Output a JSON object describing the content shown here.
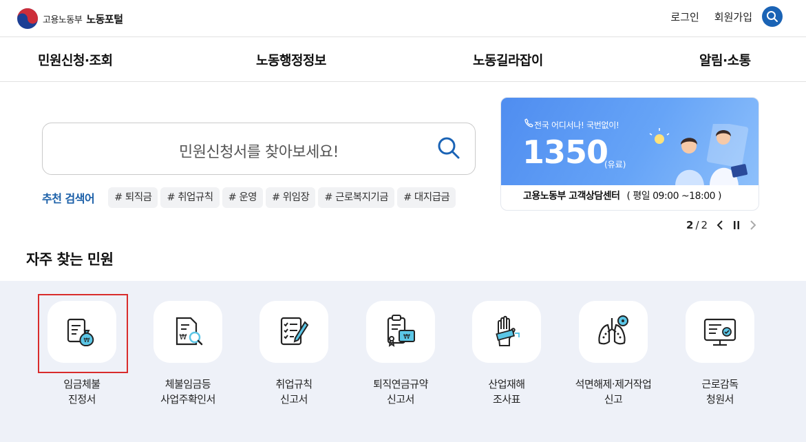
{
  "header": {
    "ministry": "고용노동부",
    "portal": "노동포털",
    "login": "로그인",
    "signup": "회원가입"
  },
  "gnb": [
    "민원신청·조회",
    "노동행정정보",
    "노동길라잡이",
    "알림·소통"
  ],
  "search": {
    "placeholder": "민원신청서를 찾아보세요!",
    "rec_label": "추천 검색어",
    "tags": [
      "# 퇴직금",
      "# 취업규칙",
      "# 운영",
      "# 위임장",
      "# 근로복지기금",
      "# 대지급금"
    ]
  },
  "banner": {
    "tagline": "전국 어디서나! 국번없이!",
    "number": "1350",
    "paid": "(유료)",
    "center": "고용노동부 고객상담센터",
    "hours": "( 평일 09:00 ~18:00 )"
  },
  "pager": {
    "current": "2",
    "total": "2"
  },
  "frequent": {
    "title": "자주 찾는 민원",
    "items": [
      {
        "line1": "임금체불",
        "line2": "진정서",
        "icon": "wage-claim-icon"
      },
      {
        "line1": "체불임금등",
        "line2": "사업주확인서",
        "icon": "document-search-icon"
      },
      {
        "line1": "취업규칙",
        "line2": "신고서",
        "icon": "checklist-icon"
      },
      {
        "line1": "퇴직연금규약",
        "line2": "신고서",
        "icon": "pension-doc-icon"
      },
      {
        "line1": "산업재해",
        "line2": "조사표",
        "icon": "injured-hand-icon"
      },
      {
        "line1": "석면해제·제거작업",
        "line2": "신고",
        "icon": "lungs-icon"
      },
      {
        "line1": "근로감독",
        "line2": "청원서",
        "icon": "monitor-check-icon"
      }
    ]
  },
  "colors": {
    "primary": "#1a63b5",
    "highlight": "#d82b2b",
    "section_bg": "#eef1f8"
  }
}
